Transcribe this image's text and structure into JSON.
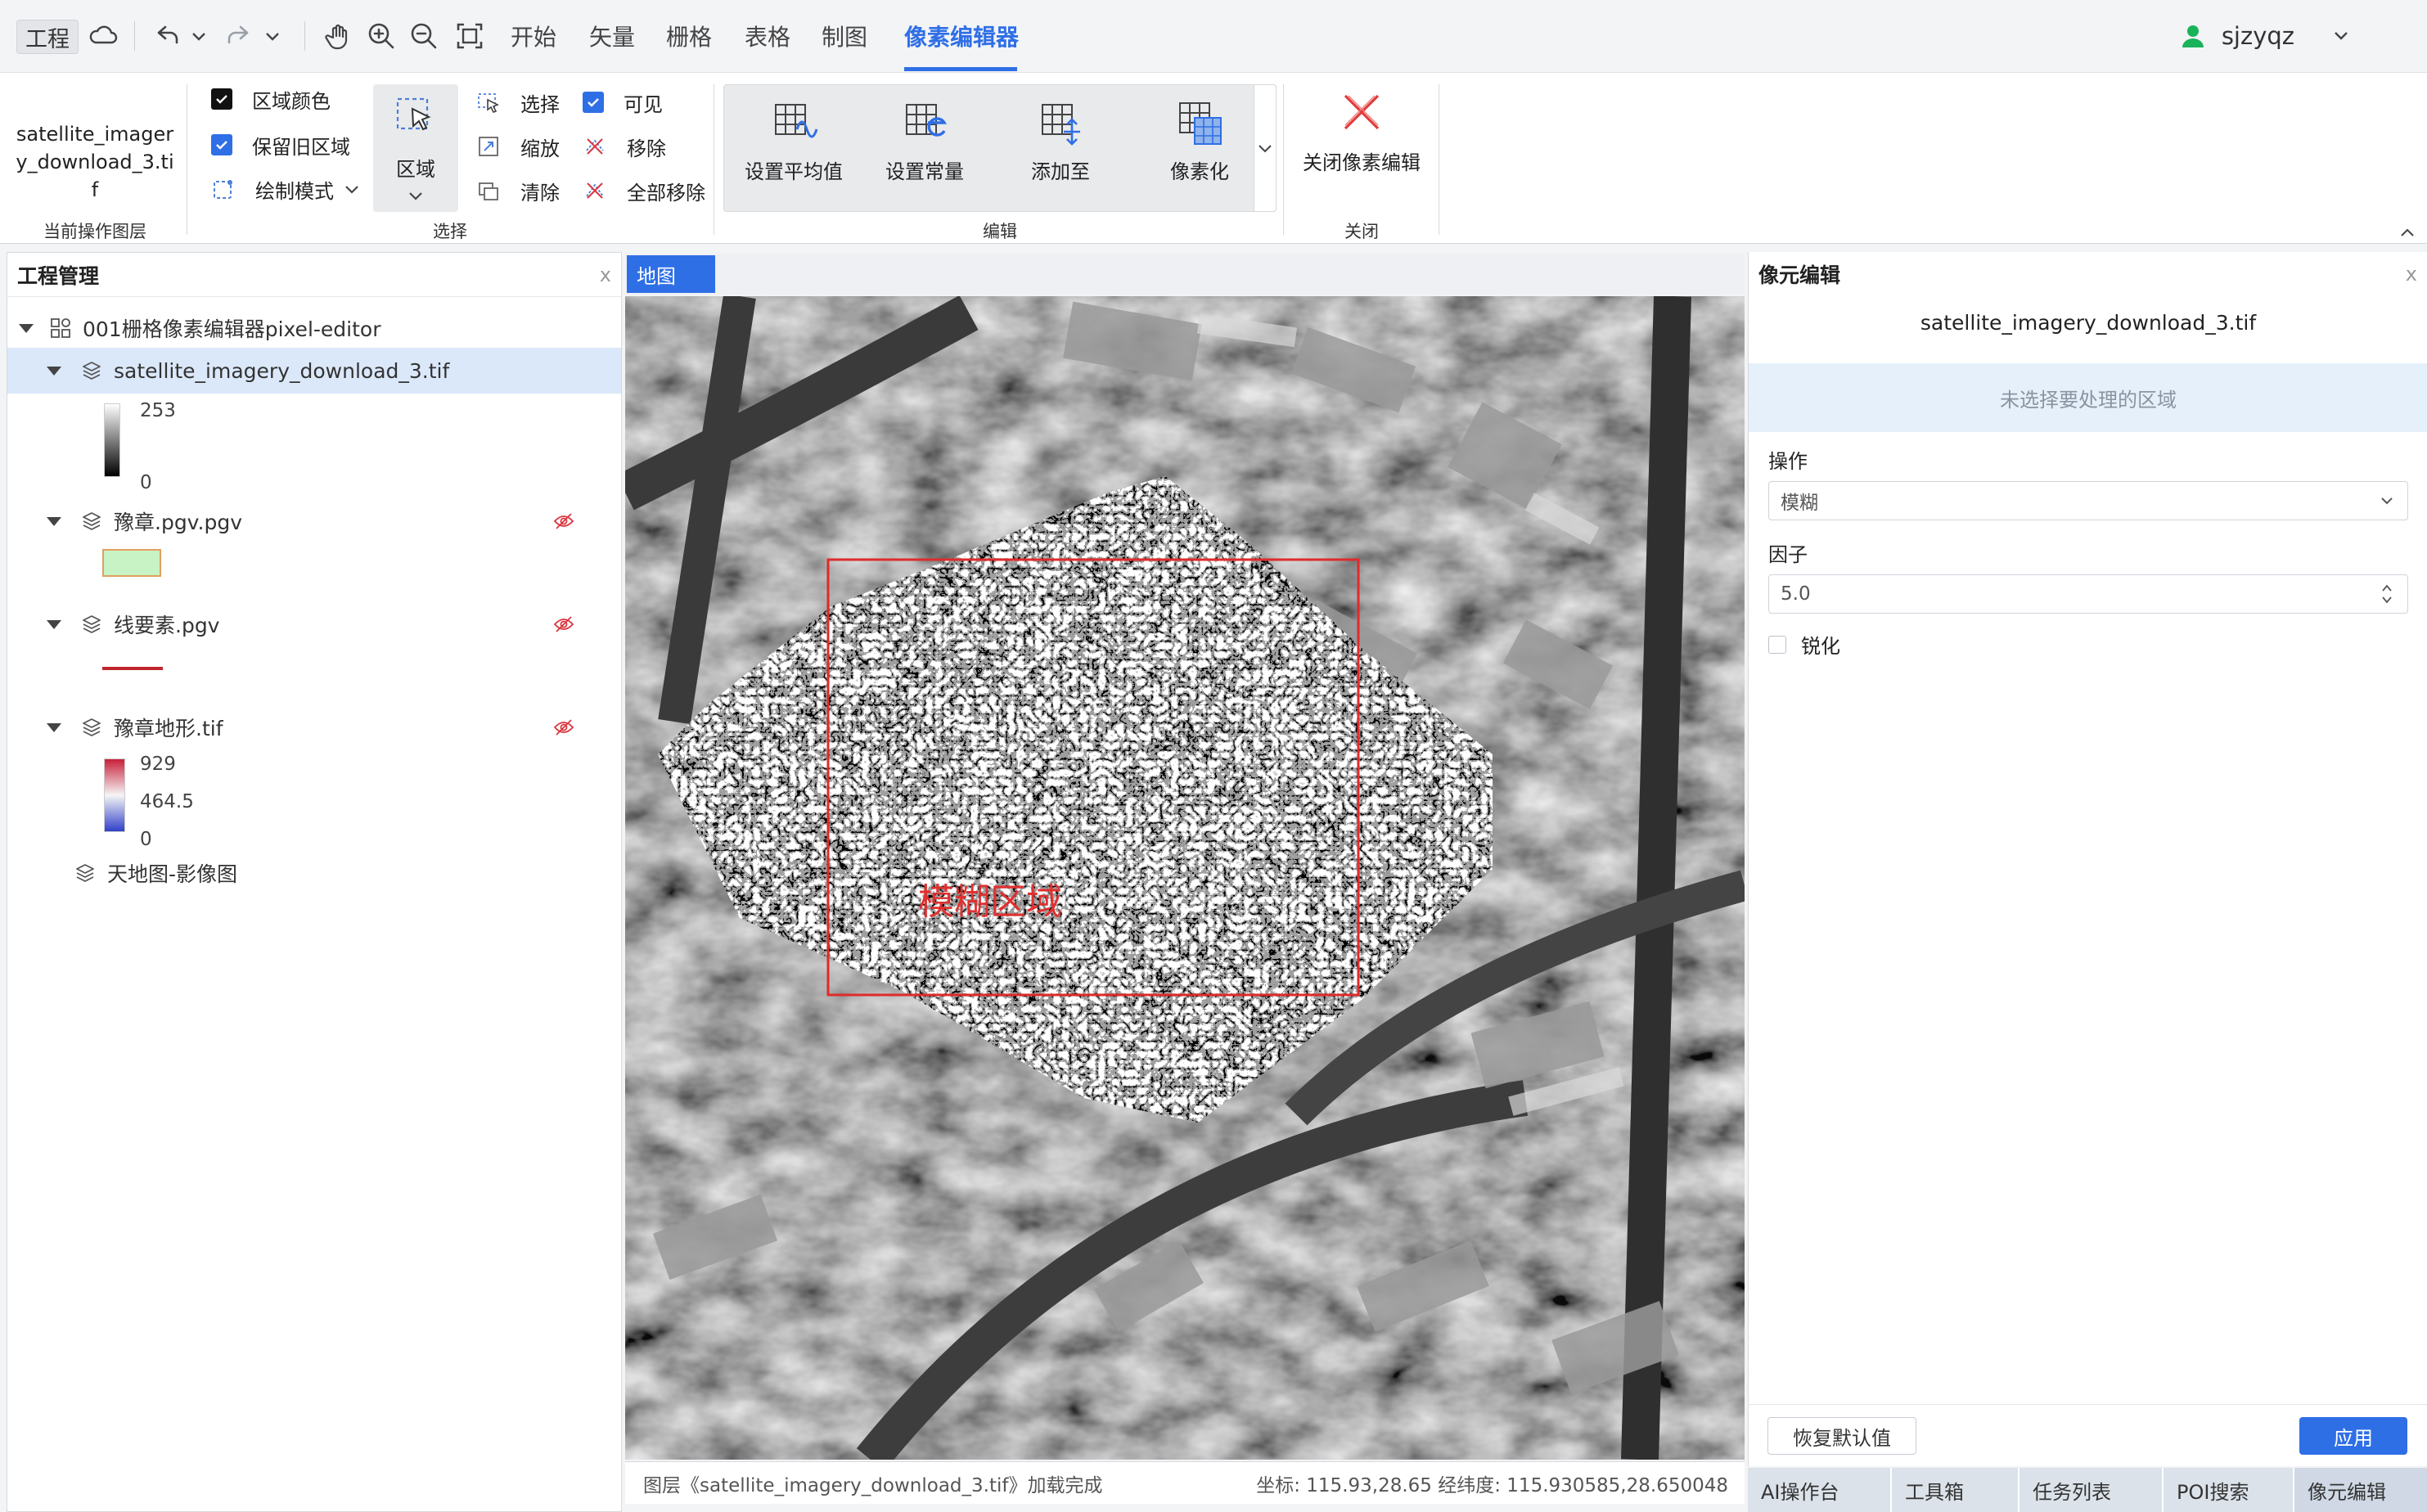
{
  "topbar": {
    "project_label": "工程",
    "menu_tabs": [
      "开始",
      "矢量",
      "栅格",
      "表格",
      "制图",
      "像素编辑器"
    ],
    "active_tab": "像素编辑器",
    "username": "sjzyqz",
    "accent_color": "#2f6fe6"
  },
  "ribbon": {
    "current_layer_name": "satellite_imagery_download_3.tif",
    "current_layer_group": "当前操作图层",
    "select_group": {
      "label": "选择",
      "region_color": "区域颜色",
      "keep_old_region": "保留旧区域",
      "draw_mode": "绘制模式",
      "region_button": "区域",
      "select": "选择",
      "zoom": "缩放",
      "clear": "清除",
      "visible": "可见",
      "remove": "移除",
      "remove_all": "全部移除"
    },
    "edit_group": {
      "label": "编辑",
      "set_average": "设置平均值",
      "set_constant": "设置常量",
      "add_to": "添加至",
      "pixelate": "像素化"
    },
    "close_group": {
      "label": "关闭",
      "close_pixel_edit": "关闭像素编辑"
    }
  },
  "project_panel": {
    "title": "工程管理",
    "close": "x",
    "root": "001栅格像素编辑器pixel-editor",
    "layers": [
      {
        "name": "satellite_imagery_download_3.tif",
        "legend_max": "253",
        "legend_min": "0"
      },
      {
        "name": "豫章.pgv.pgv"
      },
      {
        "name": "线要素.pgv"
      },
      {
        "name": "豫章地形.tif",
        "legend_max": "929",
        "legend_mid": "464.5",
        "legend_min": "0"
      },
      {
        "name": "天地图-影像图"
      }
    ]
  },
  "map": {
    "tab_label": "地图",
    "annotation": "模糊区域",
    "status_message": "图层《satellite_imagery_download_3.tif》加载完成",
    "coords": "坐标: 115.93,28.65 经纬度: 115.930585,28.650048"
  },
  "pixel_panel": {
    "title": "像元编辑",
    "close": "x",
    "file": "satellite_imagery_download_3.tif",
    "notice": "未选择要处理的区域",
    "operation_label": "操作",
    "operation_value": "模糊",
    "factor_label": "因子",
    "factor_value": "5.0",
    "sharpen_label": "锐化",
    "reset_button": "恢复默认值",
    "apply_button": "应用"
  },
  "bottom_tabs": [
    "AI操作台",
    "工具箱",
    "任务列表",
    "POI搜索",
    "像元编辑"
  ]
}
